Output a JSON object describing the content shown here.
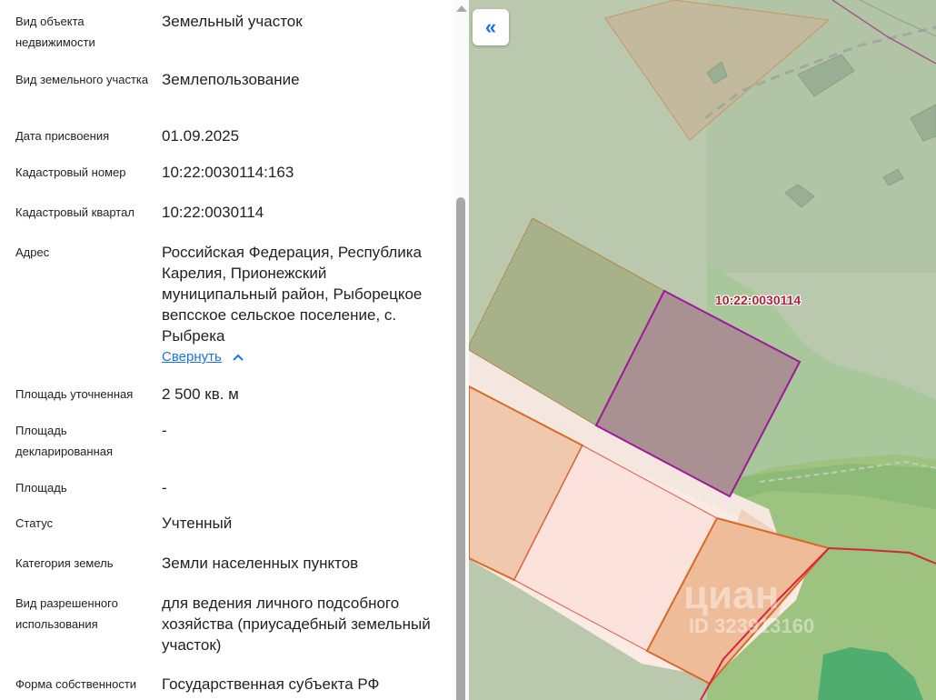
{
  "properties": [
    {
      "label": "Вид объекта недвижимости",
      "value": "Земельный участок"
    },
    {
      "label": "Вид земельного участка",
      "value": "Землепользование"
    },
    {
      "label": "Дата присвоения",
      "value": "01.09.2025"
    },
    {
      "label": "Кадастровый номер",
      "value": "10:22:0030114:163"
    },
    {
      "label": "Кадастровый квартал",
      "value": "10:22:0030114"
    },
    {
      "label": "Адрес",
      "value": "Российская Федерация, Республика Карелия, Прионежский муниципальный район, Рыборецкое вепсское сельское поселение, с. Рыбрека"
    },
    {
      "label": "Площадь уточненная",
      "value": "2 500 кв. м"
    },
    {
      "label": "Площадь декларированная",
      "value": "-"
    },
    {
      "label": "Площадь",
      "value": "-"
    },
    {
      "label": "Статус",
      "value": "Учтенный"
    },
    {
      "label": "Категория земель",
      "value": "Земли населенных пунктов"
    },
    {
      "label": "Вид разрешенного использования",
      "value": "для ведения личного подсобного хозяйства (приусадебный земельный участок)"
    },
    {
      "label": "Форма собственности",
      "value": "Государственная субъекта РФ"
    }
  ],
  "address_toggle": "Свернуть",
  "collapse_icon": "«",
  "map": {
    "parcel_label": "10:22:0030114",
    "watermark_logo": "циан",
    "watermark_id": "ID 323913160"
  },
  "colors": {
    "accent": "#1a73e8",
    "parcel_outline": "#a0189a",
    "label": "#b2223a"
  }
}
